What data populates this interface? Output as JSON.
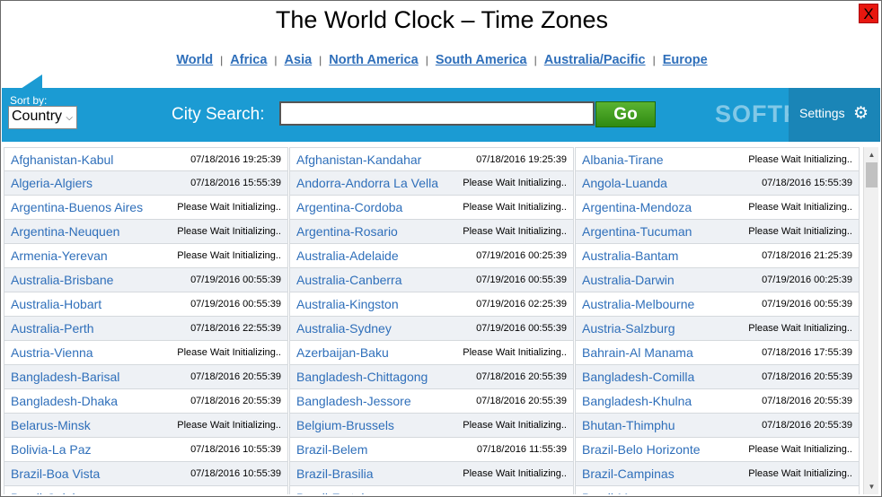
{
  "window": {
    "close_label": "X"
  },
  "header": {
    "title": "The World Clock – Time Zones"
  },
  "nav": [
    {
      "label": "World"
    },
    {
      "label": "Africa"
    },
    {
      "label": "Asia"
    },
    {
      "label": "North America"
    },
    {
      "label": "South America"
    },
    {
      "label": "Australia/Pacific"
    },
    {
      "label": "Europe"
    }
  ],
  "toolbar": {
    "sort_label": "Sort by:",
    "sort_value": "Country",
    "search_label": "City Search:",
    "search_value": "",
    "go_label": "Go",
    "watermark": "SOFTPEDIA",
    "settings_label": "Settings"
  },
  "columns": [
    [
      {
        "city": "Afghanistan-Kabul",
        "time": "07/18/2016 19:25:39"
      },
      {
        "city": "Algeria-Algiers",
        "time": "07/18/2016 15:55:39"
      },
      {
        "city": "Argentina-Buenos Aires",
        "time": "Please Wait Initializing.."
      },
      {
        "city": "Argentina-Neuquen",
        "time": "Please Wait Initializing.."
      },
      {
        "city": "Armenia-Yerevan",
        "time": "Please Wait Initializing.."
      },
      {
        "city": "Australia-Brisbane",
        "time": "07/19/2016 00:55:39"
      },
      {
        "city": "Australia-Hobart",
        "time": "07/19/2016 00:55:39"
      },
      {
        "city": "Australia-Perth",
        "time": "07/18/2016 22:55:39"
      },
      {
        "city": "Austria-Vienna",
        "time": "Please Wait Initializing.."
      },
      {
        "city": "Bangladesh-Barisal",
        "time": "07/18/2016 20:55:39"
      },
      {
        "city": "Bangladesh-Dhaka",
        "time": "07/18/2016 20:55:39"
      },
      {
        "city": "Belarus-Minsk",
        "time": "Please Wait Initializing.."
      },
      {
        "city": "Bolivia-La Paz",
        "time": "07/18/2016 10:55:39"
      },
      {
        "city": "Brazil-Boa Vista",
        "time": "07/18/2016 10:55:39"
      },
      {
        "city": "Brazil-Cuiaba",
        "time": ""
      }
    ],
    [
      {
        "city": "Afghanistan-Kandahar",
        "time": "07/18/2016 19:25:39"
      },
      {
        "city": "Andorra-Andorra La Vella",
        "time": "Please Wait Initializing.."
      },
      {
        "city": "Argentina-Cordoba",
        "time": "Please Wait Initializing.."
      },
      {
        "city": "Argentina-Rosario",
        "time": "Please Wait Initializing.."
      },
      {
        "city": "Australia-Adelaide",
        "time": "07/19/2016 00:25:39"
      },
      {
        "city": "Australia-Canberra",
        "time": "07/19/2016 00:55:39"
      },
      {
        "city": "Australia-Kingston",
        "time": "07/19/2016 02:25:39"
      },
      {
        "city": "Australia-Sydney",
        "time": "07/19/2016 00:55:39"
      },
      {
        "city": "Azerbaijan-Baku",
        "time": "Please Wait Initializing.."
      },
      {
        "city": "Bangladesh-Chittagong",
        "time": "07/18/2016 20:55:39"
      },
      {
        "city": "Bangladesh-Jessore",
        "time": "07/18/2016 20:55:39"
      },
      {
        "city": "Belgium-Brussels",
        "time": "Please Wait Initializing.."
      },
      {
        "city": "Brazil-Belem",
        "time": "07/18/2016 11:55:39"
      },
      {
        "city": "Brazil-Brasilia",
        "time": "Please Wait Initializing.."
      },
      {
        "city": "Brazil-Fortaleza",
        "time": ""
      }
    ],
    [
      {
        "city": "Albania-Tirane",
        "time": "Please Wait Initializing.."
      },
      {
        "city": "Angola-Luanda",
        "time": "07/18/2016 15:55:39"
      },
      {
        "city": "Argentina-Mendoza",
        "time": "Please Wait Initializing.."
      },
      {
        "city": "Argentina-Tucuman",
        "time": "Please Wait Initializing.."
      },
      {
        "city": "Australia-Bantam",
        "time": "07/18/2016 21:25:39"
      },
      {
        "city": "Australia-Darwin",
        "time": "07/19/2016 00:25:39"
      },
      {
        "city": "Australia-Melbourne",
        "time": "07/19/2016 00:55:39"
      },
      {
        "city": "Austria-Salzburg",
        "time": "Please Wait Initializing.."
      },
      {
        "city": "Bahrain-Al Manama",
        "time": "07/18/2016 17:55:39"
      },
      {
        "city": "Bangladesh-Comilla",
        "time": "07/18/2016 20:55:39"
      },
      {
        "city": "Bangladesh-Khulna",
        "time": "07/18/2016 20:55:39"
      },
      {
        "city": "Bhutan-Thimphu",
        "time": "07/18/2016 20:55:39"
      },
      {
        "city": "Brazil-Belo Horizonte",
        "time": "Please Wait Initializing.."
      },
      {
        "city": "Brazil-Campinas",
        "time": "Please Wait Initializing.."
      },
      {
        "city": "Brazil-Manaus",
        "time": ""
      }
    ]
  ],
  "colors": {
    "accent": "#1b9bd3",
    "link": "#2f6fba",
    "go": "#3c9a1c",
    "close": "#e8170f"
  }
}
